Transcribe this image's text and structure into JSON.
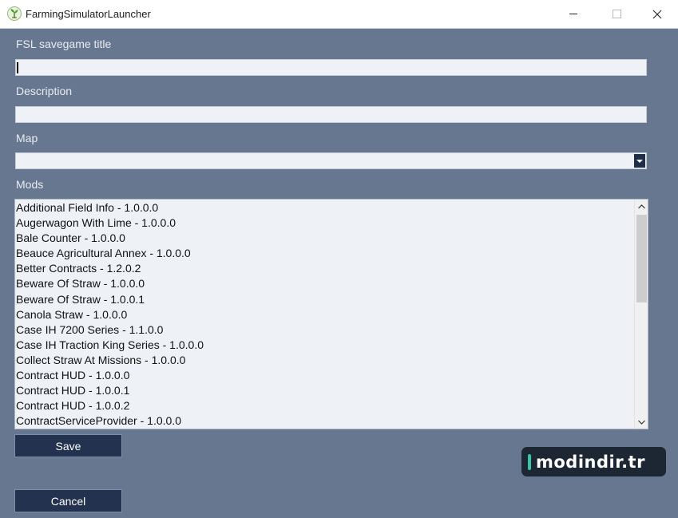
{
  "window": {
    "title": "FarmingSimulatorLauncher",
    "icon": "farming-simulator-logo-icon",
    "controls": [
      "minimize-icon",
      "maximize-icon",
      "close-icon"
    ]
  },
  "form": {
    "title_label": "FSL savegame title",
    "title_value": "",
    "description_label": "Description",
    "description_value": "",
    "map_label": "Map",
    "map_value": "",
    "mods_label": "Mods"
  },
  "mods": [
    "Additional Field Info - 1.0.0.0",
    "Augerwagon With Lime - 1.0.0.0",
    "Bale Counter - 1.0.0.0",
    "Beauce Agricultural Annex - 1.0.0.0",
    "Better Contracts - 1.2.0.2",
    "Beware Of Straw - 1.0.0.0",
    "Beware Of Straw - 1.0.0.1",
    "Canola Straw - 1.0.0.0",
    "Case IH 7200 Series - 1.1.0.0",
    "Case IH Traction King Series - 1.0.0.0",
    "Collect Straw At Missions - 1.0.0.0",
    "Contract HUD - 1.0.0.0",
    "Contract HUD - 1.0.0.1",
    "Contract HUD - 1.0.0.2",
    "ContractServiceProvider - 1.0.0.0"
  ],
  "buttons": {
    "save": "Save",
    "cancel": "Cancel"
  },
  "watermark": {
    "text": "modindir.tr"
  },
  "colors": {
    "background": "#66778f",
    "button": "#23324f",
    "field": "#eef1f6"
  }
}
